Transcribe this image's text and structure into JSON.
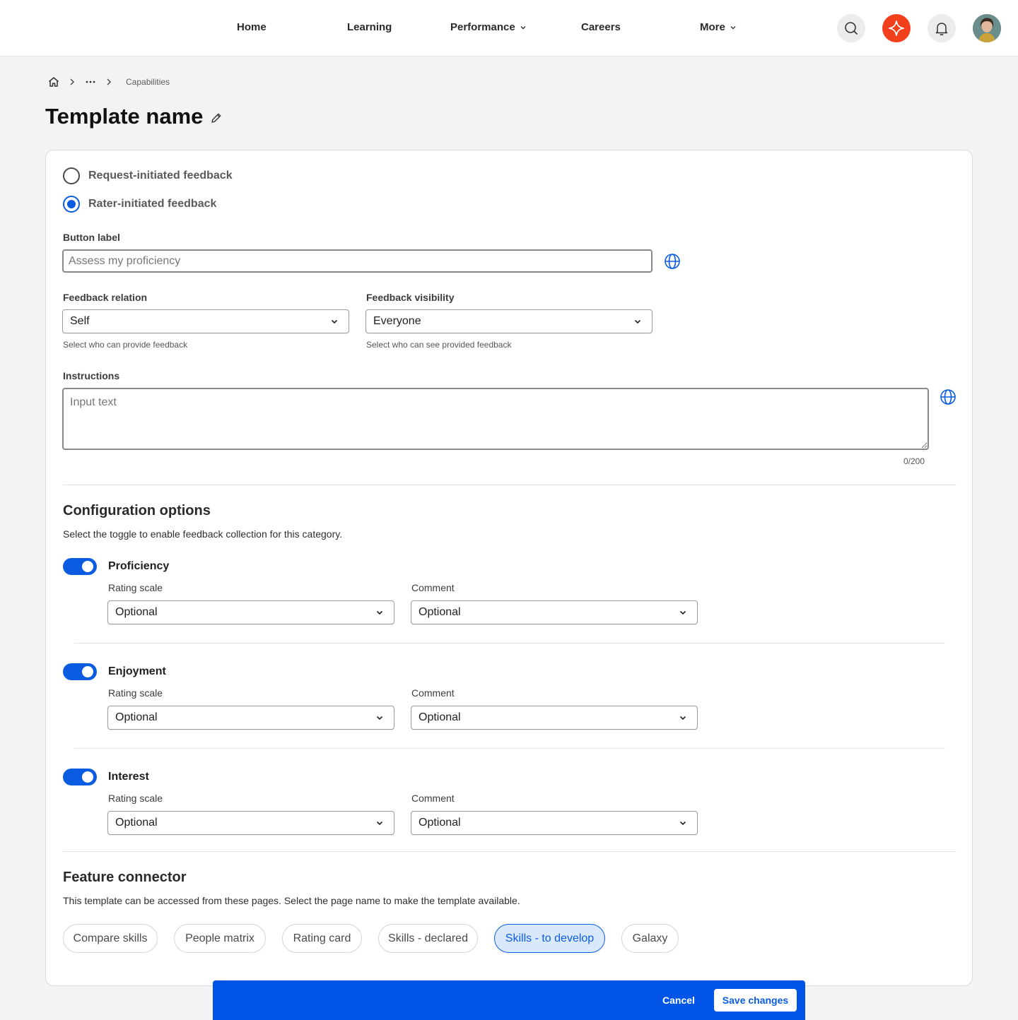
{
  "nav": {
    "items": [
      {
        "label": "Home",
        "has_dropdown": false
      },
      {
        "label": "Learning",
        "has_dropdown": false
      },
      {
        "label": "Performance",
        "has_dropdown": true
      },
      {
        "label": "Careers",
        "has_dropdown": false
      },
      {
        "label": "More",
        "has_dropdown": true
      }
    ],
    "icons": [
      "search-icon",
      "ai-sparkle-icon",
      "bell-icon",
      "avatar"
    ],
    "ai_color": "#f2401c"
  },
  "breadcrumb": {
    "icons": [
      "home-icon",
      "ellipsis-icon"
    ],
    "current": "Capabilities"
  },
  "page": {
    "title": "Template name"
  },
  "form": {
    "feedback_types": [
      {
        "label": "Request-initiated feedback",
        "checked": false
      },
      {
        "label": "Rater-initiated feedback",
        "checked": true
      }
    ],
    "button_label": {
      "label": "Button label",
      "placeholder": "Assess my proficiency"
    },
    "feedback_relation": {
      "label": "Feedback relation",
      "value": "Self",
      "helper": "Select who can provide feedback"
    },
    "feedback_visibility": {
      "label": "Feedback visibility",
      "value": "Everyone",
      "helper": "Select who can see provided feedback"
    },
    "instructions": {
      "label": "Instructions",
      "placeholder": "Input text",
      "count": "0/200"
    }
  },
  "config": {
    "title": "Configuration options",
    "description": "Select the toggle to enable feedback collection for this category.",
    "categories": [
      {
        "label": "Proficiency",
        "enabled": true,
        "rating_label": "Rating scale",
        "rating_value": "Optional",
        "comment_label": "Comment",
        "comment_value": "Optional"
      },
      {
        "label": "Enjoyment",
        "enabled": true,
        "rating_label": "Rating scale",
        "rating_value": "Optional",
        "comment_label": "Comment",
        "comment_value": "Optional"
      },
      {
        "label": "Interest",
        "enabled": true,
        "rating_label": "Rating scale",
        "rating_value": "Optional",
        "comment_label": "Comment",
        "comment_value": "Optional"
      }
    ]
  },
  "connector": {
    "title": "Feature connector",
    "description": "This template can be accessed from these pages. Select the page name to make the template available.",
    "chips": [
      {
        "label": "Compare skills",
        "selected": false
      },
      {
        "label": "People matrix",
        "selected": false
      },
      {
        "label": "Rating card",
        "selected": false
      },
      {
        "label": "Skills - declared",
        "selected": false
      },
      {
        "label": "Skills - to develop",
        "selected": true
      },
      {
        "label": "Galaxy",
        "selected": false
      }
    ]
  },
  "footer": {
    "cancel_label": "Cancel",
    "save_label": "Save changes",
    "bar_color": "#0055e6"
  }
}
